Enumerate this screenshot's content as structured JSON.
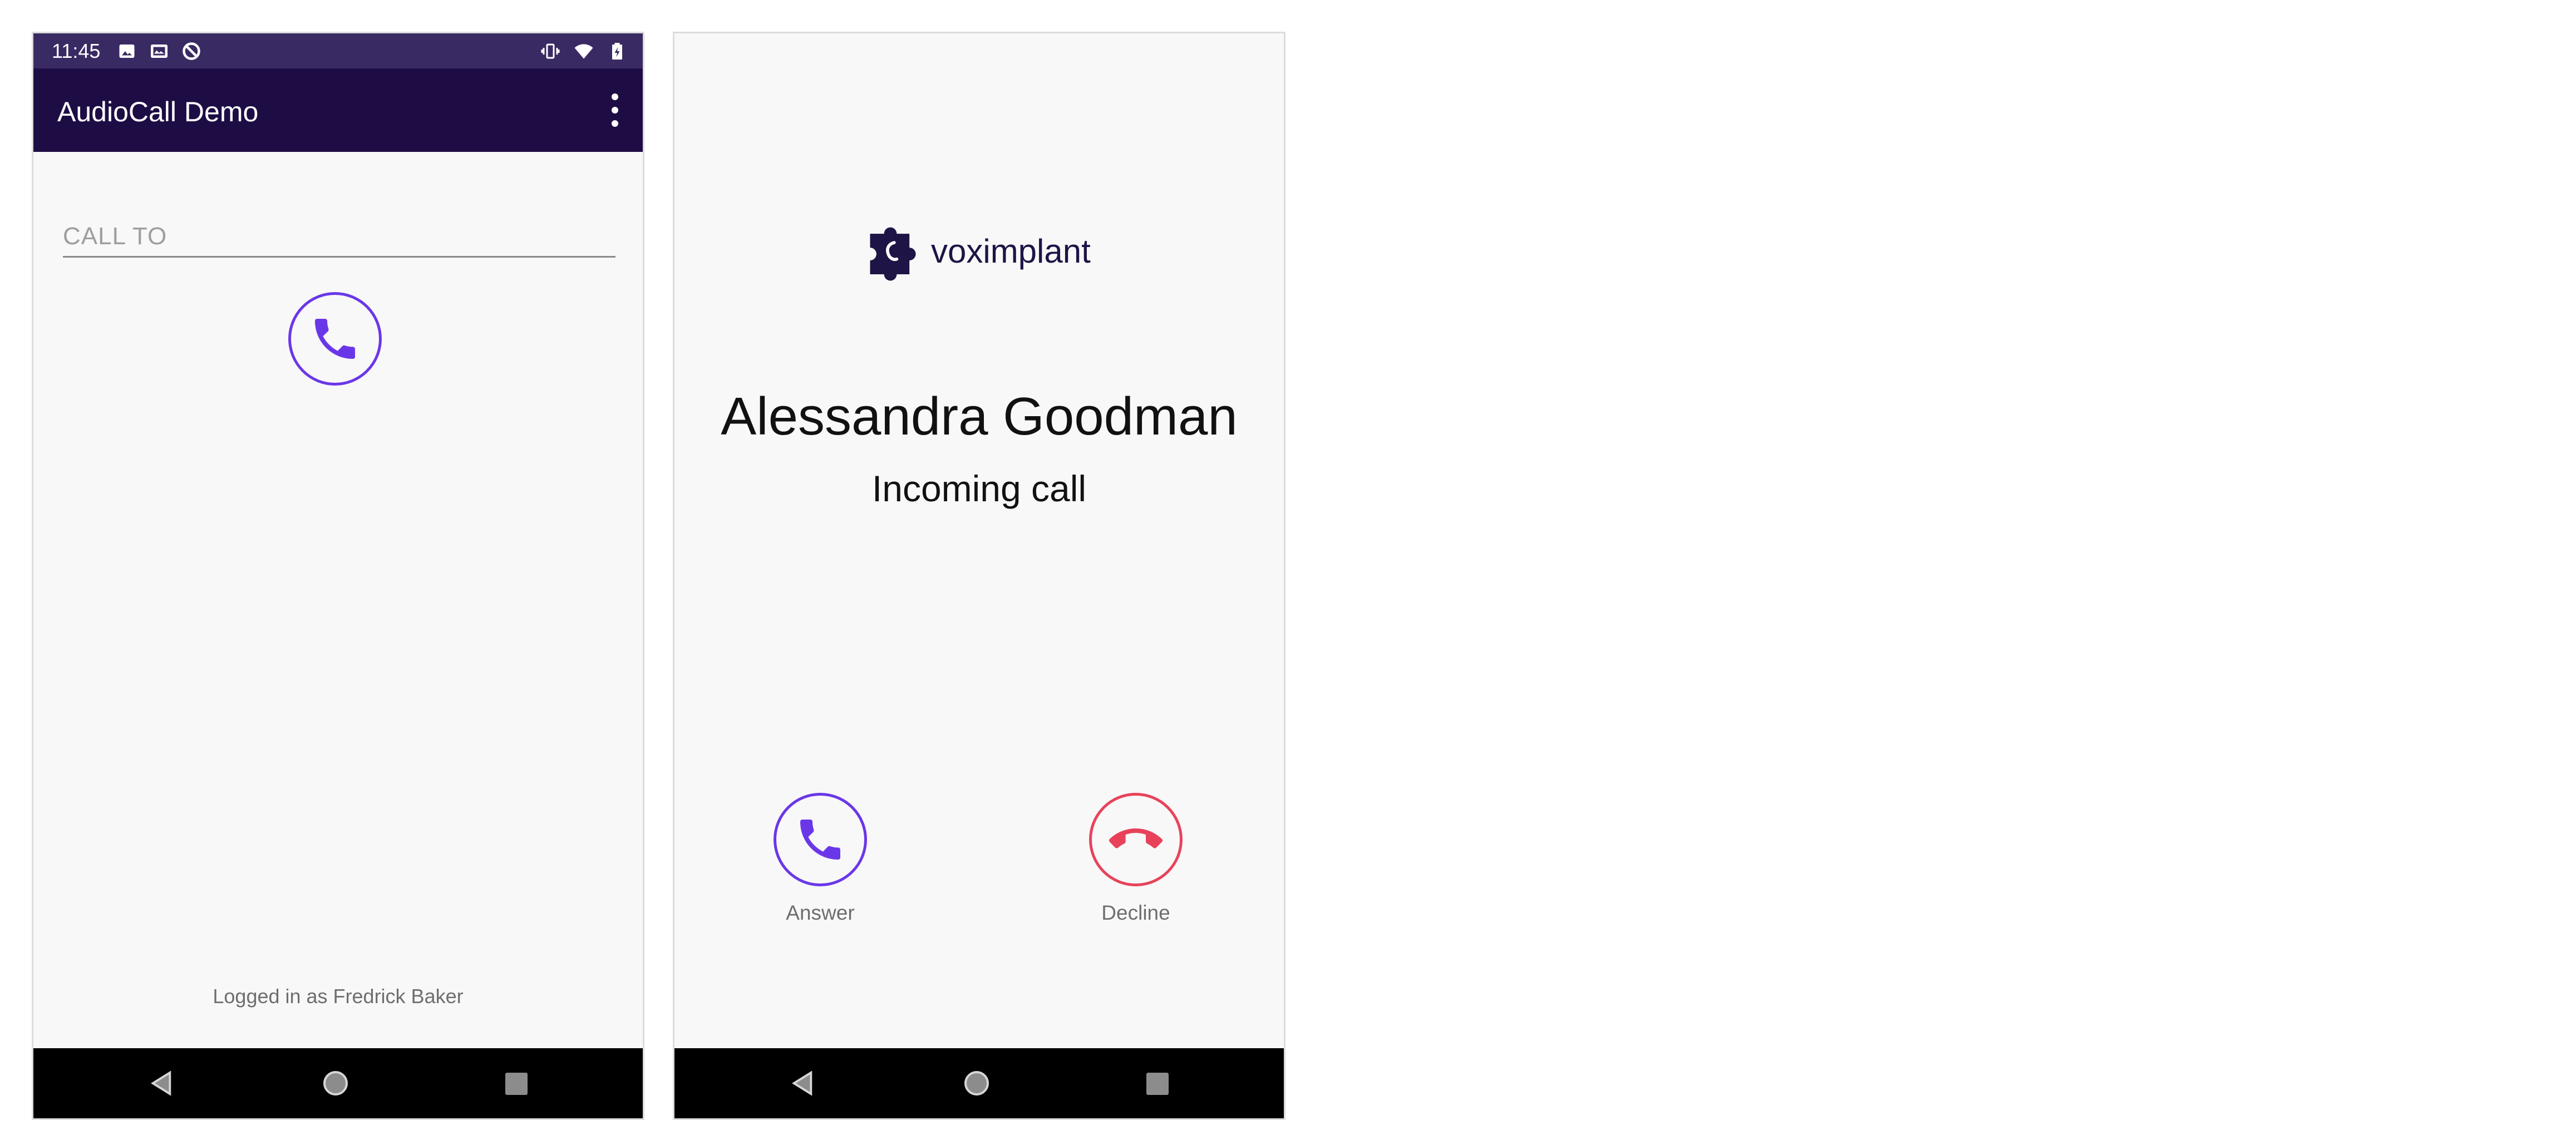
{
  "colors": {
    "status_bar": "#3a2a63",
    "toolbar": "#1e0d45",
    "accent_purple": "#6a37e8",
    "decline_red": "#e8425a",
    "background": "#f8f8f8",
    "nav_bar": "#000000"
  },
  "left_screen": {
    "status_bar": {
      "time": "11:45",
      "left_icons": [
        "image-icon",
        "gallery-icon",
        "sync-disabled-icon"
      ],
      "right_icons": [
        "vibrate-icon",
        "wifi-icon",
        "battery-icon"
      ]
    },
    "toolbar": {
      "title": "AudioCall Demo",
      "menu_icon": "more-vert-icon"
    },
    "call_input": {
      "placeholder": "CALL TO",
      "value": ""
    },
    "call_button_icon": "phone-icon",
    "footer": {
      "logged_in_text": "Logged in as Fredrick Baker"
    },
    "nav_bar": [
      "back-icon",
      "home-icon",
      "recents-icon"
    ]
  },
  "right_screen": {
    "logo": {
      "text": "voximplant",
      "icon": "voximplant-puzzle-icon"
    },
    "caller_name": "Alessandra Goodman",
    "call_status": "Incoming call",
    "actions": {
      "answer": {
        "label": "Answer",
        "icon": "phone-icon"
      },
      "decline": {
        "label": "Decline",
        "icon": "phone-hangup-icon"
      }
    },
    "nav_bar": [
      "back-icon",
      "home-icon",
      "recents-icon"
    ]
  }
}
